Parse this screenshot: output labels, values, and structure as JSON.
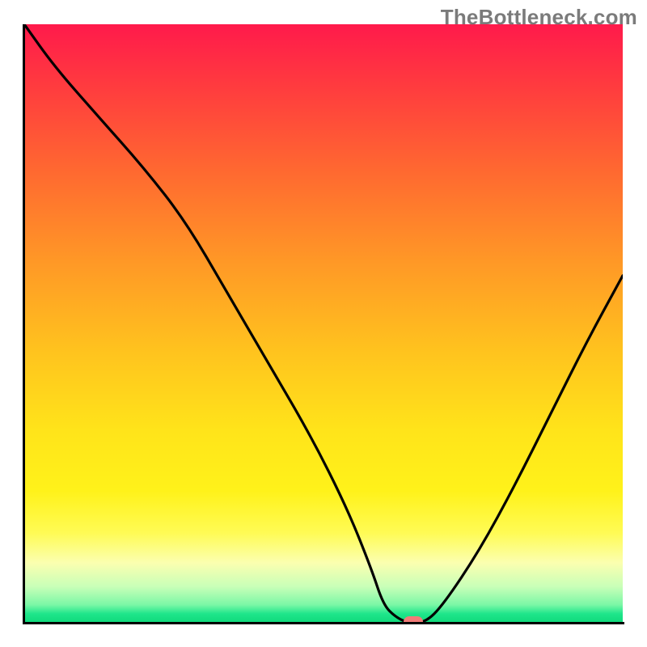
{
  "watermark": "TheBottleneck.com",
  "chart_data": {
    "type": "line",
    "title": "",
    "xlabel": "",
    "ylabel": "",
    "ylim": [
      0,
      100
    ],
    "xlim": [
      0,
      100
    ],
    "x": [
      0,
      5,
      12,
      20,
      27,
      34,
      41,
      48,
      54,
      58,
      60,
      62,
      64,
      67,
      70,
      76,
      82,
      88,
      94,
      100
    ],
    "values": [
      100,
      93,
      85,
      76,
      67,
      55,
      43,
      31,
      19,
      9,
      3,
      1,
      0,
      0,
      3,
      12,
      23,
      35,
      47,
      58
    ],
    "optimal_marker": {
      "x": 65,
      "y": 0
    },
    "gradient_colors": {
      "top": "#ff1a4b",
      "mid_high": "#ff9926",
      "mid": "#ffe41a",
      "mid_low": "#fffb55",
      "low": "#1fe68b"
    }
  }
}
